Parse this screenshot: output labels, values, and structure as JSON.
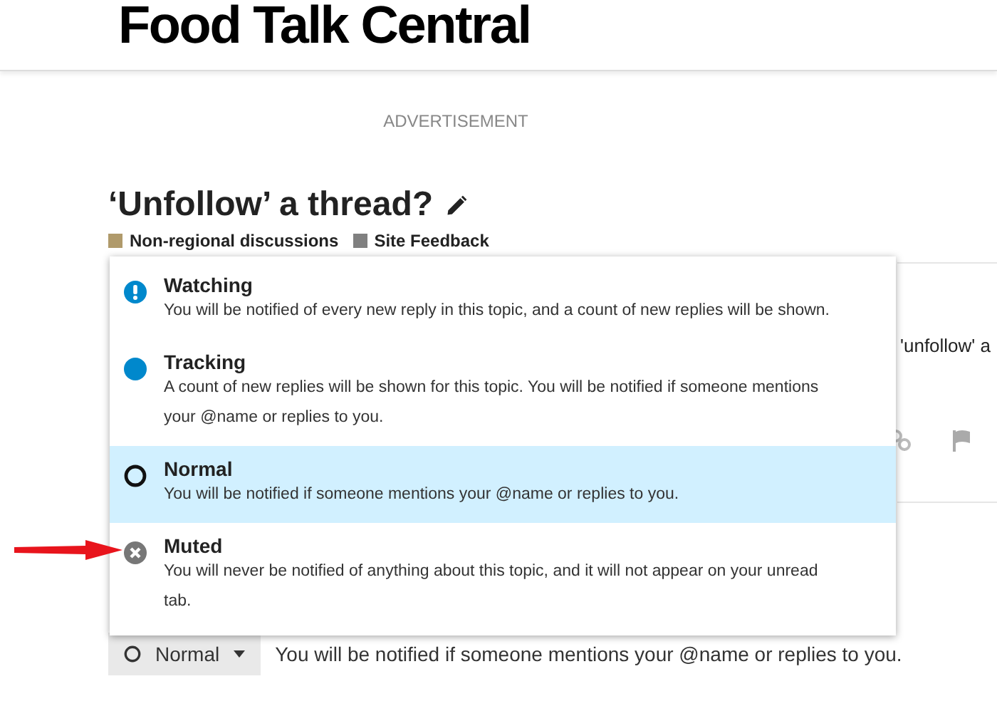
{
  "header": {
    "site_title": "Food Talk Central"
  },
  "advertisement": "ADVERTISEMENT",
  "topic": {
    "title": "‘Unfollow’ a thread?",
    "categories": [
      {
        "name": "Non-regional discussions",
        "color": "#b09a6b"
      },
      {
        "name": "Site Feedback",
        "color": "#808080"
      }
    ]
  },
  "post": {
    "text_fragment": "'unfollow' a"
  },
  "notification_menu": {
    "items": [
      {
        "kind": "watching",
        "title": "Watching",
        "description": "You will be notified of every new reply in this topic, and a count of new replies will be shown.",
        "selected": false
      },
      {
        "kind": "tracking",
        "title": "Tracking",
        "description": "A count of new replies will be shown for this topic. You will be notified if someone mentions your @name or replies to you.",
        "selected": false
      },
      {
        "kind": "normal",
        "title": "Normal",
        "description": "You will be notified if someone mentions your @name or replies to you.",
        "selected": true
      },
      {
        "kind": "muted",
        "title": "Muted",
        "description": "You will never be notified of anything about this topic, and it will not appear on your unread tab.",
        "selected": false
      }
    ]
  },
  "notification_button": {
    "label": "Normal",
    "description": "You will be notified if someone mentions your @name or replies to you."
  }
}
